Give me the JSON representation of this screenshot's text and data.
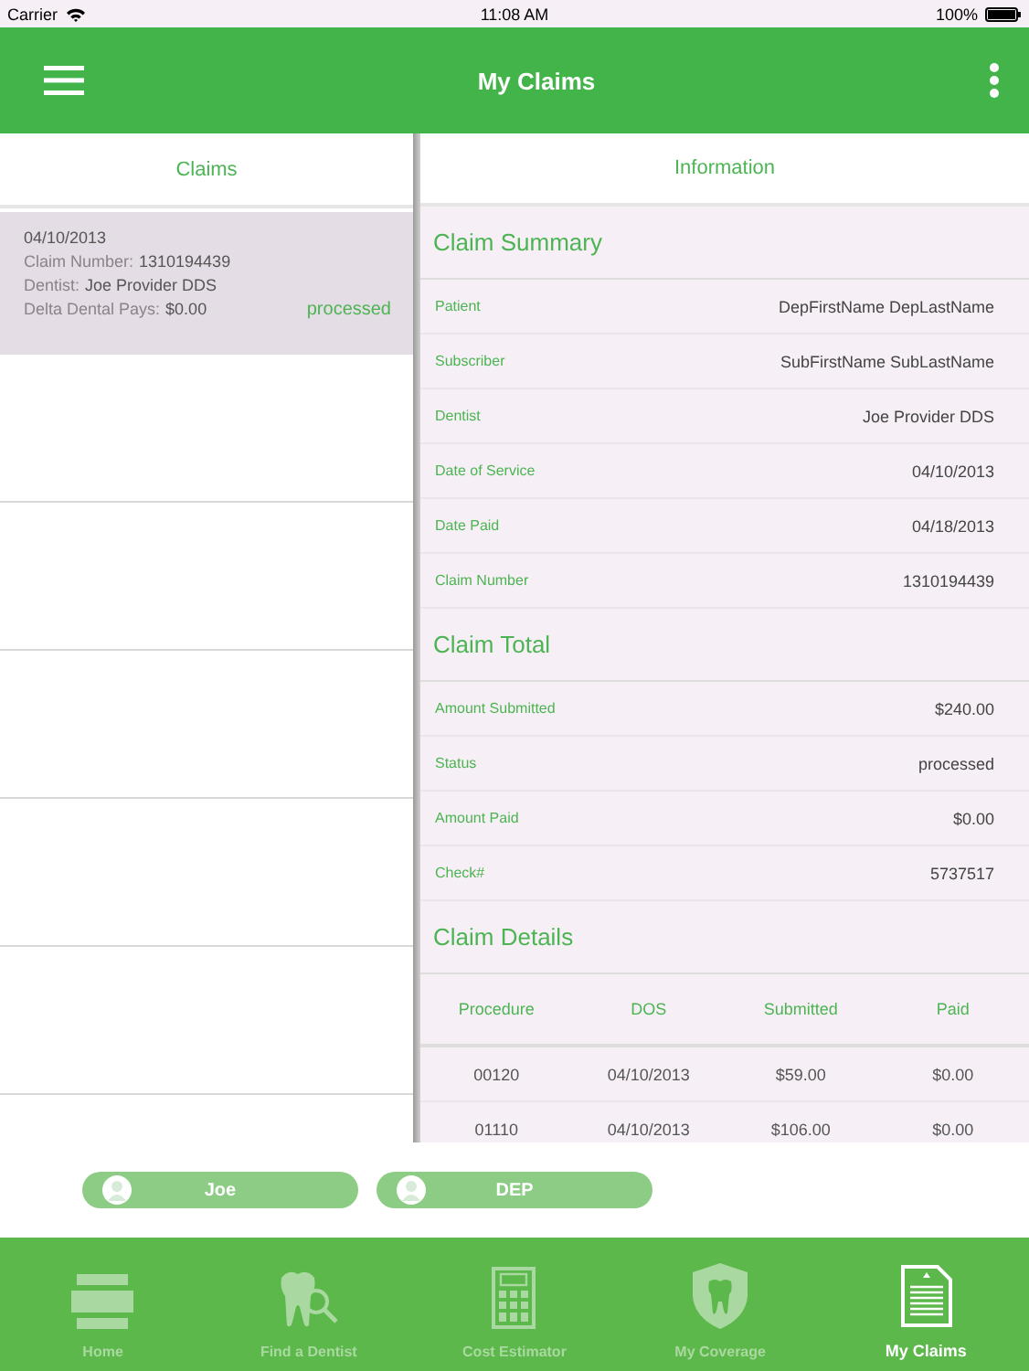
{
  "status_bar": {
    "carrier": "Carrier",
    "time": "11:08 AM",
    "battery": "100%"
  },
  "app_bar": {
    "title": "My Claims"
  },
  "claims_pane": {
    "title": "Claims",
    "claims": [
      {
        "date": "04/10/2013",
        "number_label": "Claim Number:",
        "number": "1310194439",
        "dentist_label": "Dentist:",
        "dentist": "Joe Provider DDS",
        "pays_label": "Delta Dental Pays:",
        "pays": "$0.00",
        "status": "processed",
        "selected": true
      }
    ]
  },
  "info_pane": {
    "title": "Information",
    "sections": [
      {
        "kind": "fields",
        "title": "Claim Summary",
        "rows": [
          {
            "label": "Patient",
            "value": "DepFirstName DepLastName"
          },
          {
            "label": "Subscriber",
            "value": "SubFirstName SubLastName"
          },
          {
            "label": "Dentist",
            "value": "Joe Provider DDS"
          },
          {
            "label": "Date of Service",
            "value": "04/10/2013"
          },
          {
            "label": "Date Paid",
            "value": "04/18/2013"
          },
          {
            "label": "Claim Number",
            "value": "1310194439"
          }
        ]
      },
      {
        "kind": "fields",
        "title": "Claim Total",
        "rows": [
          {
            "label": "Amount Submitted",
            "value": "$240.00"
          },
          {
            "label": "Status",
            "value": "processed"
          },
          {
            "label": "Amount Paid",
            "value": "$0.00"
          },
          {
            "label": "Check#",
            "value": "5737517"
          }
        ]
      },
      {
        "kind": "table",
        "title": "Claim Details",
        "columns": [
          "Procedure",
          "DOS",
          "Submitted",
          "Paid"
        ],
        "table_rows": [
          [
            "00120",
            "04/10/2013",
            "$59.00",
            "$0.00"
          ],
          [
            "01110",
            "04/10/2013",
            "$106.00",
            "$0.00"
          ]
        ]
      }
    ]
  },
  "members": [
    {
      "name": "Joe"
    },
    {
      "name": "DEP"
    }
  ],
  "tab_bar": [
    {
      "kind": "home",
      "label": "Home",
      "selected": false
    },
    {
      "kind": "find",
      "label": "Find a Dentist",
      "selected": false
    },
    {
      "kind": "calculator",
      "label": "Cost Estimator",
      "selected": false
    },
    {
      "kind": "coverage",
      "label": "My Coverage",
      "selected": false
    },
    {
      "kind": "claims",
      "label": "My Claims",
      "selected": true
    }
  ]
}
